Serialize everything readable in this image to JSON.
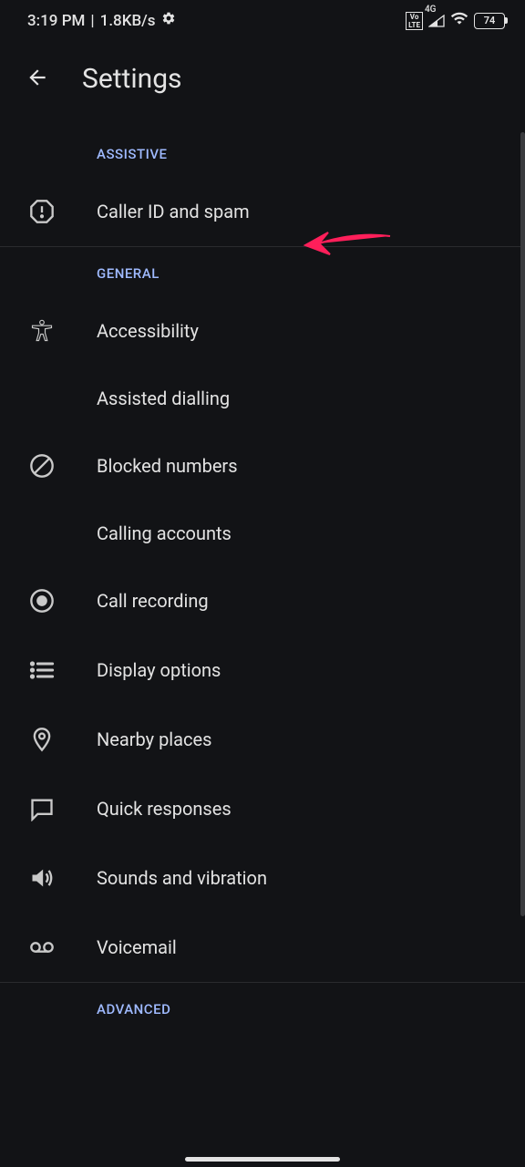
{
  "status_bar": {
    "time": "3:19 PM",
    "data_rate": "1.8KB/s",
    "volte": "Vo\nLTE",
    "network": "4G",
    "battery": "74"
  },
  "header": {
    "title": "Settings"
  },
  "sections": {
    "assistive": {
      "header": "ASSISTIVE",
      "items": [
        {
          "label": "Caller ID and spam"
        }
      ]
    },
    "general": {
      "header": "GENERAL",
      "items": [
        {
          "label": "Accessibility"
        },
        {
          "label": "Assisted dialling"
        },
        {
          "label": "Blocked numbers"
        },
        {
          "label": "Calling accounts"
        },
        {
          "label": "Call recording"
        },
        {
          "label": "Display options"
        },
        {
          "label": "Nearby places"
        },
        {
          "label": "Quick responses"
        },
        {
          "label": "Sounds and vibration"
        },
        {
          "label": "Voicemail"
        }
      ]
    },
    "advanced": {
      "header": "ADVANCED"
    }
  }
}
